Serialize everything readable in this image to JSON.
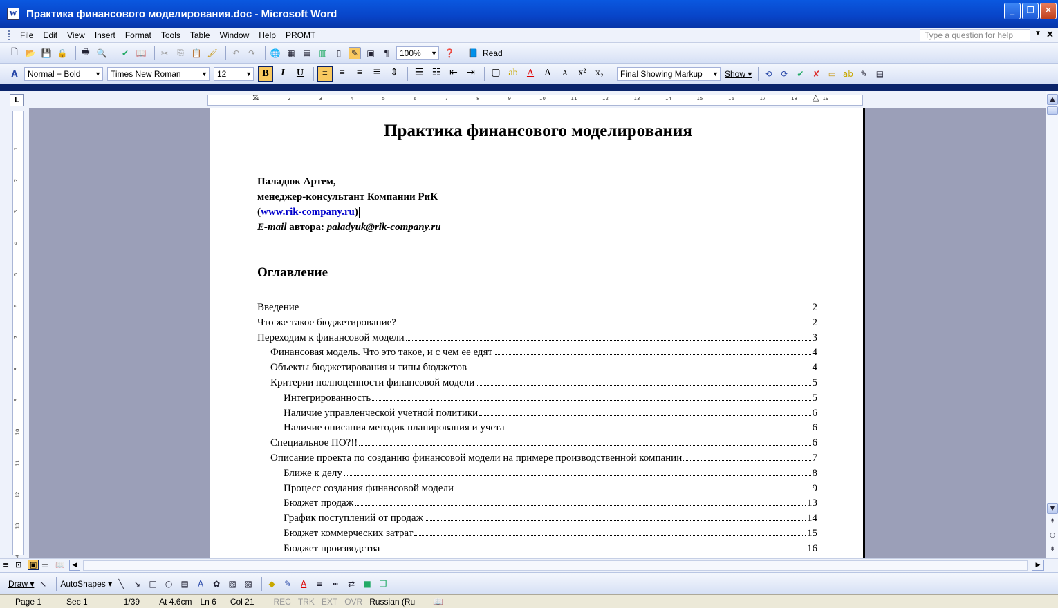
{
  "window": {
    "title": "Практика финансового моделирования.doc - Microsoft Word"
  },
  "menu": {
    "items": [
      "File",
      "Edit",
      "View",
      "Insert",
      "Format",
      "Tools",
      "Table",
      "Window",
      "Help",
      "PROMT"
    ],
    "ask_placeholder": "Type a question for help"
  },
  "toolbar": {
    "zoom": "100%",
    "read_label": "Read"
  },
  "formatting": {
    "style": "Normal + Bold",
    "font": "Times New Roman",
    "size": "12",
    "markup": "Final Showing Markup",
    "show_label": "Show"
  },
  "document": {
    "title": "Практика финансового моделирования",
    "author_lines": {
      "name": "Паладюк Артем,",
      "role": "менеджер-консультант Компании РиК",
      "link": "www.rik-company.ru",
      "email_label": "E-mail",
      "email_mid": " автора: ",
      "email": "paladyuk@rik-company.ru"
    },
    "toc_heading": "Оглавление",
    "toc": [
      {
        "text": "Введение",
        "page": "2",
        "level": 1
      },
      {
        "text": "Что же такое бюджетирование?",
        "page": "2",
        "level": 1
      },
      {
        "text": "Переходим к финансовой модели",
        "page": "3",
        "level": 1
      },
      {
        "text": "Финансовая модель. Что это такое, и с чем ее едят",
        "page": "4",
        "level": 2
      },
      {
        "text": "Объекты бюджетирования и типы бюджетов",
        "page": "4",
        "level": 2
      },
      {
        "text": "Критерии полноценности финансовой модели",
        "page": "5",
        "level": 2
      },
      {
        "text": "Интегрированность",
        "page": "5",
        "level": 3
      },
      {
        "text": "Наличие управленческой учетной политики",
        "page": "6",
        "level": 3
      },
      {
        "text": "Наличие описания методик планирования и учета",
        "page": "6",
        "level": 3
      },
      {
        "text": "Специальное ПО?!!",
        "page": "6",
        "level": 2
      },
      {
        "text": "Описание проекта по созданию финансовой модели на примере производственной компании",
        "page": "7",
        "level": 2
      },
      {
        "text": "Ближе к делу",
        "page": "8",
        "level": 3
      },
      {
        "text": "Процесс создания финансовой модели",
        "page": "9",
        "level": 3
      },
      {
        "text": "Бюджет продаж",
        "page": "13",
        "level": 3
      },
      {
        "text": "График поступлений от продаж",
        "page": "14",
        "level": 3
      },
      {
        "text": "Бюджет коммерческих затрат",
        "page": "15",
        "level": 3
      },
      {
        "text": "Бюджет производства",
        "page": "16",
        "level": 3
      }
    ]
  },
  "drawing": {
    "draw_label": "Draw",
    "autoshapes_label": "AutoShapes"
  },
  "status": {
    "page": "Page 1",
    "sec": "Sec 1",
    "pages": "1/39",
    "at": "At 4.6cm",
    "ln": "Ln 6",
    "col": "Col 21",
    "rec": "REC",
    "trk": "TRK",
    "ext": "EXT",
    "ovr": "OVR",
    "lang": "Russian (Ru"
  }
}
